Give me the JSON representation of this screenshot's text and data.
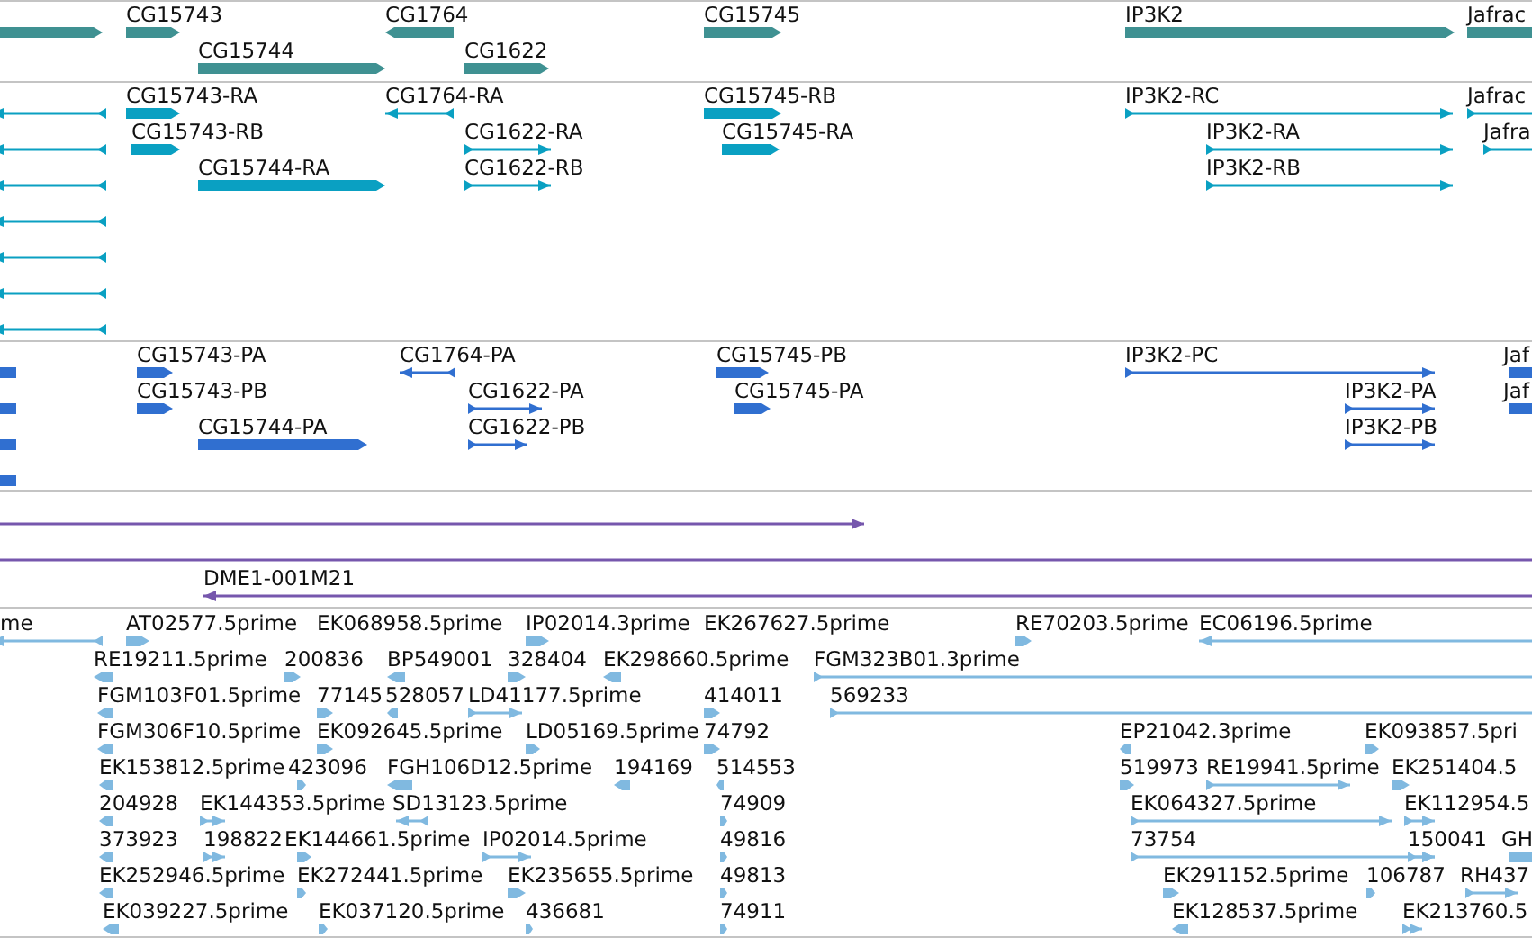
{
  "tracks": [
    {
      "kind": "genes",
      "color": "#3f9192",
      "features": [
        {
          "reverse": false
        },
        {
          "label": "CG15743",
          "reverse": false
        },
        {
          "label": "CG1764",
          "reverse": true
        },
        {
          "label": "CG15745",
          "reverse": false
        },
        {
          "label": "IP3K2",
          "reverse": false
        },
        {
          "label": "Jafrac",
          "reverse": false
        },
        {
          "label": "CG15744",
          "reverse": false
        },
        {
          "label": "CG1622",
          "reverse": false
        }
      ]
    },
    {
      "kind": "transcripts",
      "color": "#0aa0c2",
      "features": [
        {
          "reverse": true
        },
        {
          "label": "CG15743-RA",
          "reverse": false
        },
        {
          "label": "CG1764-RA",
          "reverse": true
        },
        {
          "label": "CG15745-RB",
          "reverse": false
        },
        {
          "label": "IP3K2-RC",
          "reverse": false
        },
        {
          "label": "Jafrac",
          "reverse": false
        },
        {
          "reverse": true
        },
        {
          "label": "CG15743-RB",
          "reverse": false
        },
        {
          "label": "CG1622-RA",
          "reverse": false
        },
        {
          "label": "CG15745-RA",
          "reverse": false
        },
        {
          "label": "IP3K2-RA",
          "reverse": false
        },
        {
          "label": "Jafra",
          "reverse": false
        },
        {
          "reverse": true
        },
        {
          "label": "CG15744-RA",
          "reverse": false
        },
        {
          "label": "CG1622-RB",
          "reverse": false
        },
        {
          "label": "IP3K2-RB",
          "reverse": false
        },
        {
          "reverse": true
        },
        {
          "reverse": true
        },
        {
          "reverse": true
        },
        {
          "reverse": true
        }
      ]
    },
    {
      "kind": "proteins",
      "color": "#306fd0",
      "features": [
        {
          "reverse": true
        },
        {
          "label": "CG15743-PA",
          "reverse": false
        },
        {
          "label": "CG1764-PA",
          "reverse": true
        },
        {
          "label": "CG15745-PB",
          "reverse": false
        },
        {
          "label": "IP3K2-PC",
          "reverse": false
        },
        {
          "label": "Jaf",
          "reverse": false
        },
        {
          "reverse": true
        },
        {
          "label": "CG15743-PB",
          "reverse": false
        },
        {
          "label": "CG1622-PA",
          "reverse": false
        },
        {
          "label": "CG15745-PA",
          "reverse": false
        },
        {
          "label": "IP3K2-PA",
          "reverse": false
        },
        {
          "label": "Jaf",
          "reverse": false
        },
        {
          "reverse": true
        },
        {
          "label": "CG15744-PA",
          "reverse": false
        },
        {
          "label": "CG1622-PB",
          "reverse": false
        },
        {
          "label": "IP3K2-PB",
          "reverse": false
        },
        {
          "reverse": true
        }
      ]
    },
    {
      "kind": "clones",
      "color": "#7657ad",
      "features": [
        {
          "reverse": false
        },
        {
          "reverse": false
        },
        {
          "label": "DME1-001M21",
          "reverse": true
        }
      ]
    },
    {
      "kind": "ests",
      "color": "#80b9e0",
      "features": [
        {
          "label": "me",
          "reverse": true
        },
        {
          "label": "AT02577.5prime",
          "reverse": false
        },
        {
          "label": "EK068958.5prime"
        },
        {
          "label": "IP02014.3prime",
          "reverse": false
        },
        {
          "label": "EK267627.5prime"
        },
        {
          "label": "RE70203.5prime",
          "reverse": false
        },
        {
          "label": "EC06196.5prime",
          "reverse": true
        },
        {
          "label": "RE19211.5prime",
          "reverse": true
        },
        {
          "label": "200836",
          "reverse": false
        },
        {
          "label": "BP549001",
          "reverse": true
        },
        {
          "label": "328404",
          "reverse": false
        },
        {
          "label": "EK298660.5prime",
          "reverse": true
        },
        {
          "label": "FGM323B01.3prime",
          "reverse": false
        },
        {
          "label": "FGM103F01.5prime",
          "reverse": true
        },
        {
          "label": "77145",
          "reverse": false
        },
        {
          "label": "528057",
          "reverse": true
        },
        {
          "label": "LD41177.5prime",
          "reverse": false
        },
        {
          "label": "414011",
          "reverse": false
        },
        {
          "label": "569233",
          "reverse": false
        },
        {
          "label": "FGM306F10.5prime",
          "reverse": true
        },
        {
          "label": "EK092645.5prime",
          "reverse": false
        },
        {
          "label": "LD05169.5prime",
          "reverse": false
        },
        {
          "label": "74792",
          "reverse": false
        },
        {
          "label": "EP21042.3prime",
          "reverse": true
        },
        {
          "label": "EK093857.5pri",
          "reverse": false
        },
        {
          "label": "EK153812.5prime",
          "reverse": true
        },
        {
          "label": "423096",
          "reverse": false
        },
        {
          "label": "FGH106D12.5prime",
          "reverse": true
        },
        {
          "label": "194169",
          "reverse": true
        },
        {
          "label": "514553",
          "reverse": true
        },
        {
          "label": "519973",
          "reverse": false
        },
        {
          "label": "RE19941.5prime",
          "reverse": false
        },
        {
          "label": "EK251404.5",
          "reverse": false
        },
        {
          "label": "204928",
          "reverse": true
        },
        {
          "label": "EK144353.5prime",
          "reverse": false
        },
        {
          "label": "SD13123.5prime",
          "reverse": true
        },
        {
          "label": "74909",
          "reverse": false
        },
        {
          "label": "EK064327.5prime",
          "reverse": false
        },
        {
          "label": "EK112954.5",
          "reverse": false
        },
        {
          "label": "373923",
          "reverse": true
        },
        {
          "label": "198822",
          "reverse": false
        },
        {
          "label": "EK144661.5prime",
          "reverse": false
        },
        {
          "label": "IP02014.5prime",
          "reverse": false
        },
        {
          "label": "49816",
          "reverse": false
        },
        {
          "label": "73754",
          "reverse": false
        },
        {
          "label": "150041",
          "reverse": false
        },
        {
          "label": "GH",
          "reverse": false
        },
        {
          "label": "EK252946.5prime",
          "reverse": true
        },
        {
          "label": "EK272441.5prime",
          "reverse": false
        },
        {
          "label": "EK235655.5prime",
          "reverse": false
        },
        {
          "label": "49813",
          "reverse": false
        },
        {
          "label": "EK291152.5prime",
          "reverse": false
        },
        {
          "label": "106787",
          "reverse": false
        },
        {
          "label": "RH437",
          "reverse": false
        },
        {
          "label": "EK039227.5prime",
          "reverse": true
        },
        {
          "label": "EK037120.5prime",
          "reverse": false
        },
        {
          "label": "436681",
          "reverse": false
        },
        {
          "label": "74911",
          "reverse": false
        },
        {
          "label": "EK128537.5prime",
          "reverse": true
        },
        {
          "label": "EK213760.5",
          "reverse": false
        }
      ]
    }
  ]
}
